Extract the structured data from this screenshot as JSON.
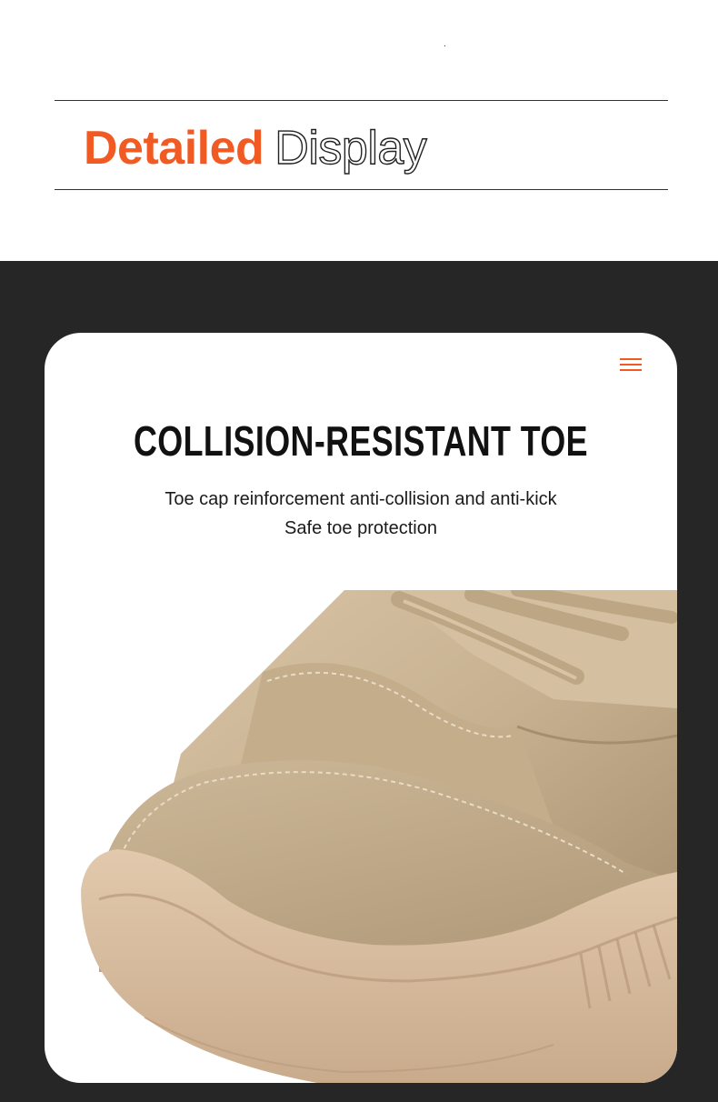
{
  "header": {
    "title_solid": "Detailed",
    "title_outline": "Display"
  },
  "feature": {
    "title": "COLLISION-RESISTANT TOE",
    "description_line1": "Toe cap reinforcement anti-collision and anti-kick",
    "description_line2": "Safe toe protection",
    "menu_icon": "hamburger-menu-icon"
  },
  "colors": {
    "accent": "#f15a22",
    "dark_background": "#262626",
    "shoe_leather": "#c8b497",
    "shoe_sole": "#d2b79b"
  }
}
